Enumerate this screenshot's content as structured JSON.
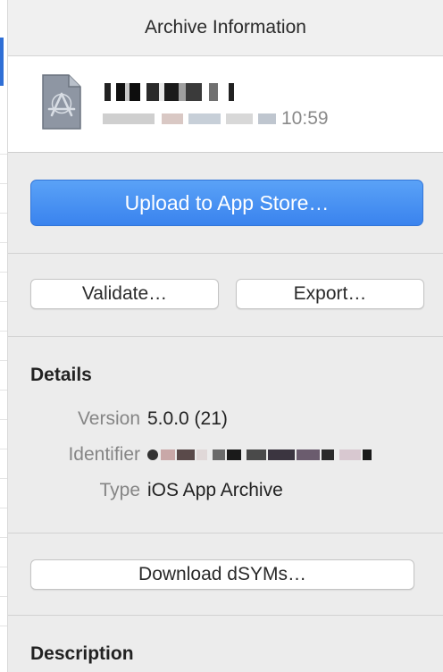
{
  "header": {
    "title": "Archive Information"
  },
  "archive": {
    "name_redacted": true,
    "date_suffix": "10:59",
    "icon": "app-archive-icon"
  },
  "actions": {
    "upload_label": "Upload to App Store…",
    "validate_label": "Validate…",
    "export_label": "Export…",
    "download_dsyms_label": "Download dSYMs…"
  },
  "details": {
    "title": "Details",
    "rows": [
      {
        "key": "Version",
        "value": "5.0.0 (21)"
      },
      {
        "key": "Identifier",
        "value": "",
        "redacted": true
      },
      {
        "key": "Type",
        "value": "iOS App Archive"
      }
    ]
  },
  "description": {
    "title": "Description"
  },
  "colors": {
    "accent": "#3a83ee",
    "selection": "#2f6fd6",
    "background": "#ececec"
  }
}
